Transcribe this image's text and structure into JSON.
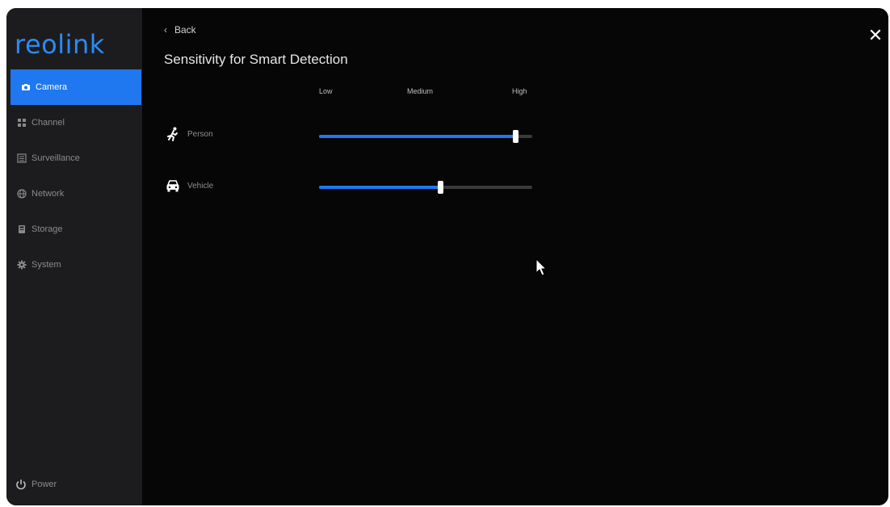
{
  "app": {
    "logo_text": "reolink",
    "brand_color": "#1f78ef"
  },
  "sidebar": {
    "items": [
      {
        "label": "Camera",
        "icon": "camera-icon",
        "active": true
      },
      {
        "label": "Channel",
        "icon": "channel-icon",
        "active": false
      },
      {
        "label": "Surveillance",
        "icon": "surveillance-icon",
        "active": false
      },
      {
        "label": "Network",
        "icon": "network-icon",
        "active": false
      },
      {
        "label": "Storage",
        "icon": "storage-icon",
        "active": false
      },
      {
        "label": "System",
        "icon": "system-gear-icon",
        "active": false
      }
    ],
    "power_label": "Power"
  },
  "header": {
    "back_label": "Back",
    "title": "Sensitivity for Smart Detection"
  },
  "scale": {
    "low": "Low",
    "medium": "Medium",
    "high": "High"
  },
  "sliders": [
    {
      "label": "Person",
      "icon": "person-running-icon",
      "value": 0.92
    },
    {
      "label": "Vehicle",
      "icon": "car-icon",
      "value": 0.57
    }
  ]
}
